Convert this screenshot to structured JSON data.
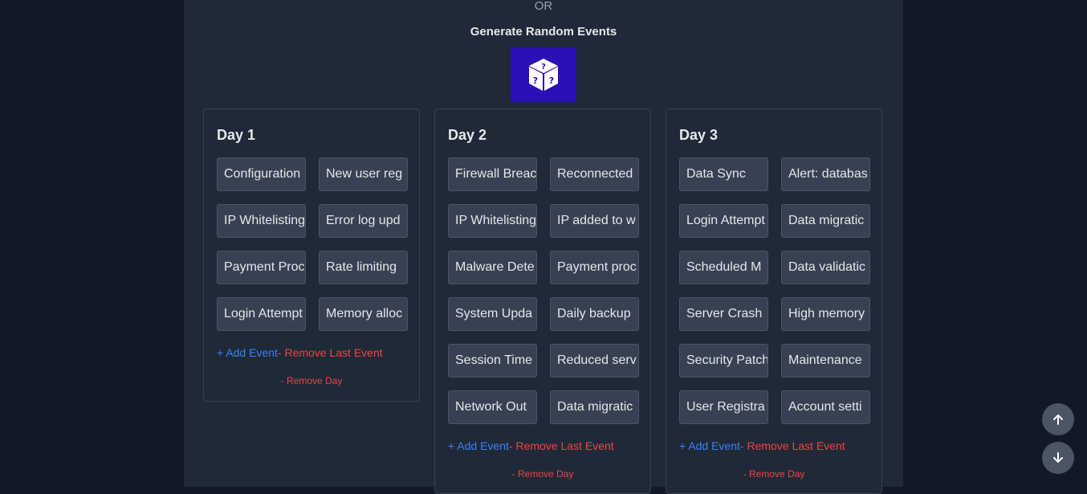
{
  "or_label": "OR",
  "generate_title": "Generate Random Events",
  "dice_icon": "dice-question-icon",
  "add_event_label": "+ Add Event",
  "remove_last_event_label": "- Remove Last Event",
  "remove_day_label": "- Remove Day",
  "days": [
    {
      "title": "Day 1",
      "events": [
        "Configuration",
        "New user reg",
        "IP Whitelisting",
        "Error log upd",
        "Payment Proc",
        "Rate limiting",
        "Login Attempt",
        "Memory alloc"
      ]
    },
    {
      "title": "Day 2",
      "events": [
        "Firewall Breach",
        "Reconnected",
        "IP Whitelisting",
        "IP added to w",
        "Malware Dete",
        "Payment proc",
        "System Upda",
        "Daily backup",
        "Session Time",
        "Reduced serv",
        "Network Out",
        "Data migratic"
      ]
    },
    {
      "title": "Day 3",
      "events": [
        "Data Sync",
        "Alert: databas",
        "Login Attempt",
        "Data migratic",
        "Scheduled M",
        "Data validatic",
        "Server Crash",
        "High memory",
        "Security Patch",
        "Maintenance",
        "User Registra",
        "Account setti"
      ]
    }
  ],
  "scroll_up_icon": "arrow-up-icon",
  "scroll_down_icon": "arrow-down-icon",
  "colors": {
    "background": "#111827",
    "panel": "#1f2937",
    "dice_button": "#2a10b5",
    "add_link": "#3b82f6",
    "remove_link": "#ef4444"
  }
}
